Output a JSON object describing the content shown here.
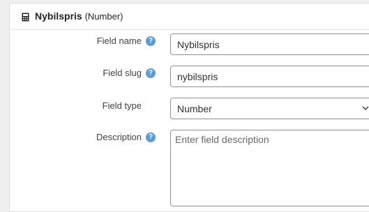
{
  "header": {
    "field_label": "Nybilspris",
    "field_type": "(Number)",
    "icon": "calculator-icon"
  },
  "form": {
    "field_name": {
      "label": "Field name",
      "value": "Nybilspris"
    },
    "field_slug": {
      "label": "Field slug",
      "value": "nybilspris"
    },
    "field_type": {
      "label": "Field type",
      "selected": "Number"
    },
    "description": {
      "label": "Description",
      "placeholder": "Enter field description",
      "value": ""
    }
  },
  "help_glyph": "?",
  "colors": {
    "help_icon": "#5b9dd9",
    "input_border": "#8c8f94",
    "background": "#f0f0f1"
  }
}
